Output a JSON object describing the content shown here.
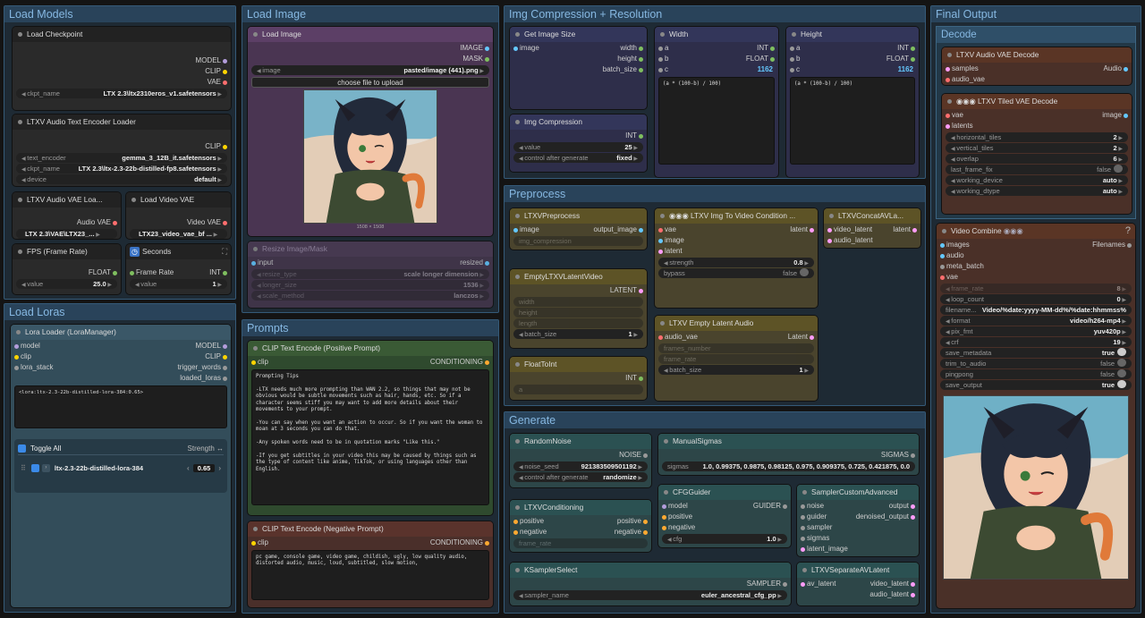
{
  "groups": {
    "load_models": "Load Models",
    "load_image": "Load Image",
    "img_compression": "Img Compression + Resolution",
    "final_output": "Final Output",
    "load_loras": "Load Loras",
    "prompts": "Prompts",
    "preprocess": "Preprocess",
    "generate": "Generate",
    "decode": "Decode"
  },
  "load_checkpoint": {
    "title": "Load Checkpoint",
    "outputs": [
      "MODEL",
      "CLIP",
      "VAE"
    ],
    "ckpt_name_label": "ckpt_name",
    "ckpt_name_value": "LTX 2.3\\ltx2310eros_v1.safetensors"
  },
  "audio_text_encoder": {
    "title": "LTXV Audio Text Encoder Loader",
    "output": "CLIP",
    "text_encoder_label": "text_encoder",
    "text_encoder_value": "gemma_3_12B_it.safetensors",
    "ckpt_name_label": "ckpt_name",
    "ckpt_name_value": "LTX 2.3\\ltx-2.3-22b-distilled-fp8.safetensors",
    "device_label": "device",
    "device_value": "default"
  },
  "audio_vae_loader": {
    "title": "LTXV Audio VAE Loa...",
    "output": "Audio VAE",
    "value": "LTX 2.3\\VAE\\LTX23_..."
  },
  "load_video_vae": {
    "title": "Load Video VAE",
    "output": "Video VAE",
    "value": "LTX23_video_vae_bf ..."
  },
  "fps": {
    "title": "FPS (Frame Rate)",
    "output": "FLOAT",
    "label": "value",
    "value": "25.0"
  },
  "seconds": {
    "title": "Seconds",
    "input": "Frame Rate",
    "output": "INT",
    "label": "value",
    "value": "1"
  },
  "load_image_node": {
    "title": "Load Image",
    "outputs": [
      "IMAGE",
      "MASK"
    ],
    "image_label": "image",
    "image_value": "pasted/image (441).png",
    "upload_button": "choose file to upload",
    "caption": "1508 × 1508"
  },
  "resize_image": {
    "title": "Resize Image/Mask",
    "input": "input",
    "output": "resized",
    "resize_type_label": "resize_type",
    "resize_type_value": "scale longer dimension",
    "longer_size_label": "longer_size",
    "longer_size_value": "1536",
    "scale_method_label": "scale_method",
    "scale_method_value": "lanczos"
  },
  "get_image_size": {
    "title": "Get Image Size",
    "input": "image",
    "outputs": [
      "width",
      "height",
      "batch_size"
    ]
  },
  "width_node": {
    "title": "Width",
    "inputs": [
      "a",
      "b",
      "c"
    ],
    "outputs": [
      "INT",
      "FLOAT"
    ],
    "c_value": "1162",
    "expression": "(a * (100-b) / 100)"
  },
  "height_node": {
    "title": "Height",
    "inputs": [
      "a",
      "b",
      "c"
    ],
    "outputs": [
      "INT",
      "FLOAT"
    ],
    "c_value": "1162",
    "expression": "(a * (100-b) / 100)"
  },
  "img_compression_node": {
    "title": "Img Compression",
    "output": "INT",
    "value_label": "value",
    "value_value": "25",
    "control_label": "control after generate",
    "control_value": "fixed"
  },
  "lora_loader": {
    "title": "Lora Loader (LoraManager)",
    "inputs": [
      "model",
      "clip",
      "lora_stack"
    ],
    "outputs": [
      "MODEL",
      "CLIP",
      "trigger_words",
      "loaded_loras"
    ],
    "text": "<lora:ltx-2.3-22b-distilled-lora-384:0.65>",
    "toggle_all": "Toggle All",
    "strength_header": "Strength ↔",
    "lora_name": "ltx-2.3-22b-distilled-lora-384",
    "lora_strength": "0.65"
  },
  "clip_positive": {
    "title": "CLIP Text Encode (Positive Prompt)",
    "input": "clip",
    "output": "CONDITIONING",
    "text": "Prompting Tips\n\n-LTX needs much more prompting than WAN 2.2, so things that may not be obvious would be subtle movements such as hair, hands, etc. So if a character seems stiff you may want to add more details about their movements to your prompt.\n\n-You can say when you want an action to occur. So if you want the woman to moan at 3 seconds you can do that.\n\n-Any spoken words need to be in quotation marks \"Like this.\"\n\n-If you get subtitles in your video this may be caused by things such as the type of content like anime, TikTok, or using languages other than English."
  },
  "clip_negative": {
    "title": "CLIP Text Encode (Negative Prompt)",
    "input": "clip",
    "output": "CONDITIONING",
    "text": "pc game, console game, video game, childish, ugly, low quality audio, distorted audio, music, loud, subtitled, slow motion,"
  },
  "ltxv_preprocess": {
    "title": "LTXVPreprocess",
    "input": "image",
    "output": "output_image",
    "widget": "img_compression"
  },
  "empty_latent_video": {
    "title": "EmptyLTXVLatentVideo",
    "output": "LATENT",
    "widgets": [
      "width",
      "height",
      "length"
    ],
    "batch_label": "batch_size",
    "batch_value": "1"
  },
  "float_to_int": {
    "title": "FloatToInt",
    "output": "INT",
    "widget": "a"
  },
  "img_to_video": {
    "title": "◉◉◉ LTXV Img To Video Condition ...",
    "inputs": [
      "vae",
      "image",
      "latent"
    ],
    "output": "latent",
    "strength_label": "strength",
    "strength_value": "0.8",
    "bypass_label": "bypass",
    "bypass_value": "false"
  },
  "concat_av": {
    "title": "LTXVConcatAVLa...",
    "inputs": [
      "video_latent",
      "audio_latent"
    ],
    "output": "latent"
  },
  "empty_latent_audio": {
    "title": "LTXV Empty Latent Audio",
    "input": "audio_vae",
    "output": "Latent",
    "widgets": [
      "frames_number",
      "frame_rate"
    ],
    "batch_label": "batch_size",
    "batch_value": "1"
  },
  "random_noise": {
    "title": "RandomNoise",
    "output": "NOISE",
    "seed_label": "noise_seed",
    "seed_value": "921383509501192",
    "control_label": "control after generate",
    "control_value": "randomize"
  },
  "manual_sigmas": {
    "title": "ManualSigmas",
    "output": "SIGMAS",
    "label": "sigmas",
    "value": "1.0, 0.99375, 0.9875, 0.98125, 0.975, 0.909375, 0.725, 0.421875, 0.0"
  },
  "ltxv_conditioning": {
    "title": "LTXVConditioning",
    "inputs": [
      "positive",
      "negative"
    ],
    "outputs": [
      "positive",
      "negative"
    ],
    "widget": "frame_rate"
  },
  "cfg_guider": {
    "title": "CFGGuider",
    "inputs": [
      "model",
      "positive",
      "negative"
    ],
    "output": "GUIDER",
    "cfg_label": "cfg",
    "cfg_value": "1.0"
  },
  "sampler_custom": {
    "title": "SamplerCustomAdvanced",
    "inputs": [
      "noise",
      "guider",
      "sampler",
      "sigmas",
      "latent_image"
    ],
    "outputs": [
      "output",
      "denoised_output"
    ]
  },
  "ksampler_select": {
    "title": "KSamplerSelect",
    "output": "SAMPLER",
    "label": "sampler_name",
    "value": "euler_ancestral_cfg_pp"
  },
  "separate_av": {
    "title": "LTXVSeparateAVLatent",
    "input": "av_latent",
    "outputs": [
      "video_latent",
      "audio_latent"
    ]
  },
  "audio_vae_decode": {
    "title": "LTXV Audio VAE Decode",
    "inputs": [
      "samples",
      "audio_vae"
    ],
    "output": "Audio"
  },
  "tiled_vae_decode": {
    "title": "◉◉◉ LTXV Tiled VAE Decode",
    "inputs": [
      "vae",
      "latents"
    ],
    "output": "image",
    "widgets": [
      {
        "k": "horizontal_tiles",
        "v": "2"
      },
      {
        "k": "vertical_tiles",
        "v": "2"
      },
      {
        "k": "overlap",
        "v": "6"
      }
    ],
    "toggles": [
      {
        "k": "last_frame_fix",
        "v": "false"
      }
    ],
    "combos": [
      {
        "k": "working_device",
        "v": "auto"
      },
      {
        "k": "working_dtype",
        "v": "auto"
      }
    ]
  },
  "video_combine": {
    "title": "Video Combine",
    "title_suffix": "◉◉◉",
    "help": "?",
    "inputs": [
      "images",
      "audio",
      "meta_batch",
      "vae"
    ],
    "output": "Filenames",
    "rows": [
      {
        "k": "frame_rate",
        "v": "8",
        "dim": true,
        "type": "num"
      },
      {
        "k": "loop_count",
        "v": "0",
        "type": "num"
      },
      {
        "k": "filename...",
        "v": "Video/%date:yyyy-MM-dd%/%date:hhmmss%",
        "type": "txt"
      },
      {
        "k": "format",
        "v": "video/h264-mp4",
        "type": "num"
      },
      {
        "k": "pix_fmt",
        "v": "yuv420p",
        "type": "num"
      },
      {
        "k": "crf",
        "v": "19",
        "type": "num"
      },
      {
        "k": "save_metadata",
        "v": "true",
        "type": "tog"
      },
      {
        "k": "trim_to_audio",
        "v": "false",
        "type": "tog"
      },
      {
        "k": "pingpong",
        "v": "false",
        "type": "tog"
      },
      {
        "k": "save_output",
        "v": "true",
        "type": "tog"
      }
    ]
  },
  "colors": {
    "group_border": "#355a78",
    "group_title": "#86b8e2",
    "image_blue": "#64c8ff",
    "clip_yellow": "#ffd500",
    "vae_red": "#ff6e6e",
    "model_purple": "#b39ddb",
    "latent_pink": "#ff9cf9",
    "cond_orange": "#ffa931",
    "int_green": "#7fbf5f"
  },
  "icons": {
    "node_dot": "circle-icon",
    "seconds": "clock-icon",
    "expand": "expand-icon",
    "drag": "drag-handle-icon",
    "help": "help-icon"
  }
}
